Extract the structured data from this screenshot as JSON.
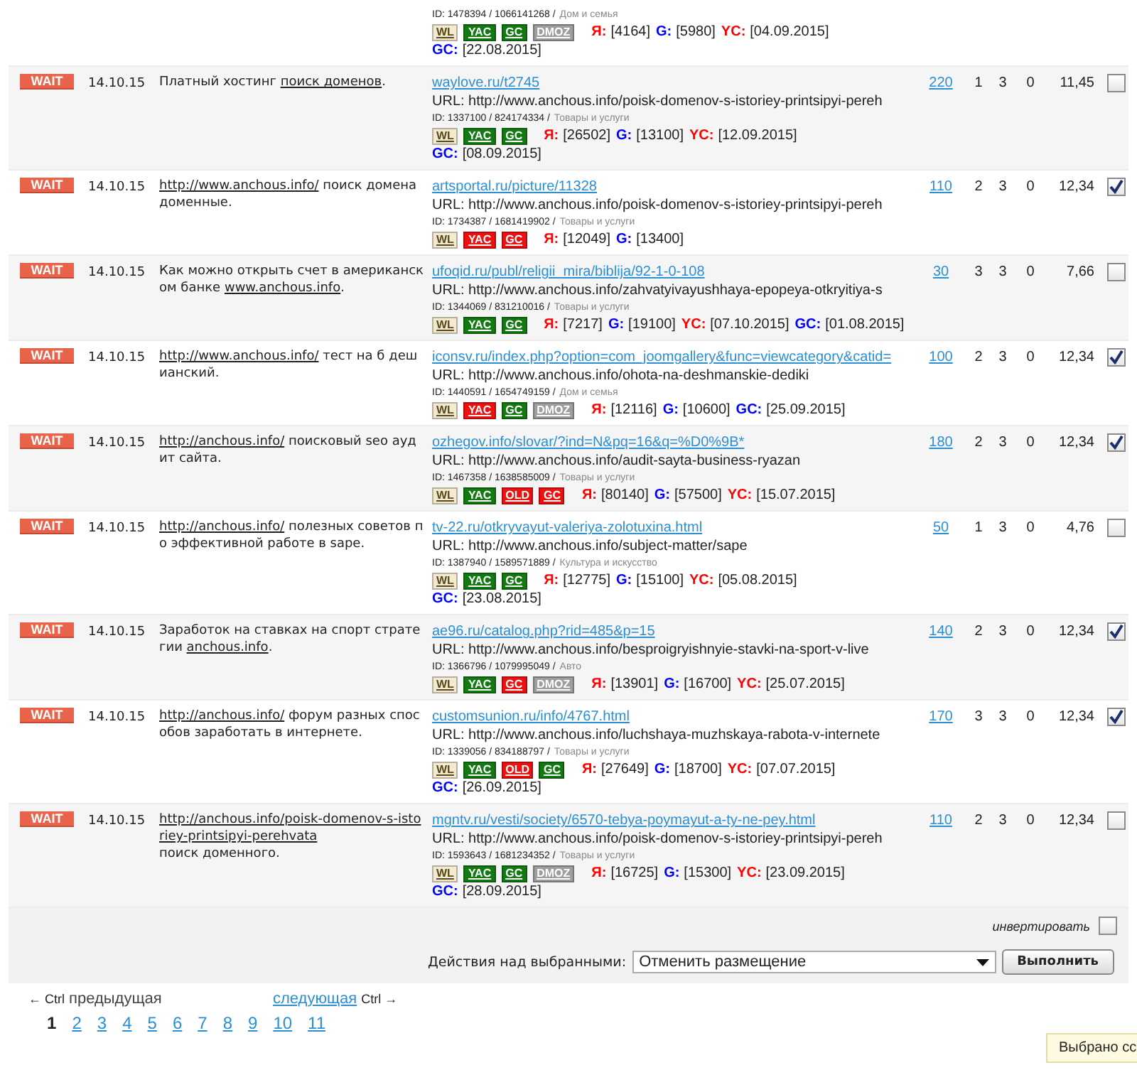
{
  "rows": [
    {
      "id": "ID: 1478394 / 1066141268 /",
      "category": "Дом и семья",
      "badges": [
        {
          "label": "WL",
          "color": "#f3ead2"
        },
        {
          "label": "YAC",
          "color": "#137a13"
        },
        {
          "label": "GC",
          "color": "#137a13"
        },
        {
          "label": "DMOZ",
          "color": "#9e9e9e"
        }
      ],
      "metrics": [
        {
          "label": "Я:",
          "value": "[4164]",
          "color": "#ff0000"
        },
        {
          "label": "G:",
          "value": "[5980]",
          "color": "#0000ff"
        },
        {
          "label": "YC:",
          "value": "[04.09.2015]",
          "color": "#ff0000"
        }
      ],
      "metrics_line2": [
        {
          "label": "GC:",
          "value": "[22.08.2015]",
          "color": "#0000ff"
        }
      ]
    },
    {
      "status": "WAIT",
      "date": "14.10.15",
      "description": [
        {
          "kind": "text",
          "text": "Платный хостинг "
        },
        {
          "kind": "link",
          "text": "поиск доменов"
        },
        {
          "kind": "text",
          "text": "."
        }
      ],
      "site": "waylove.ru/t2745",
      "url": "URL: http://www.anchous.info/poisk-domenov-s-istoriey-printsipyi-pereh",
      "id": "ID: 1337100 / 824174334 /",
      "category": "Товары и услуги",
      "badges": [
        {
          "label": "WL",
          "color": "#f3ead2"
        },
        {
          "label": "YAC",
          "color": "#137a13"
        },
        {
          "label": "GC",
          "color": "#137a13"
        }
      ],
      "metrics": [
        {
          "label": "Я:",
          "value": "[26502]",
          "color": "#ff0000"
        },
        {
          "label": "G:",
          "value": "[13100]",
          "color": "#0000ff"
        },
        {
          "label": "YC:",
          "value": "[12.09.2015]",
          "color": "#ff0000"
        }
      ],
      "metrics_line2": [
        {
          "label": "GC:",
          "value": "[08.09.2015]",
          "color": "#0000ff"
        }
      ],
      "price": "220",
      "n1": "1",
      "n2": "3",
      "n3": "0",
      "amount": "11,45",
      "checked": false
    },
    {
      "status": "WAIT",
      "date": "14.10.15",
      "description": [
        {
          "kind": "link",
          "text": "http://www.anchous.info/"
        },
        {
          "kind": "text",
          "text": " поиск домена доменные."
        }
      ],
      "site": "artsportal.ru/picture/11328",
      "url": "URL: http://www.anchous.info/poisk-domenov-s-istoriey-printsipyi-pereh",
      "id": "ID: 1734387 / 1681419902 /",
      "category": "Товары и услуги",
      "badges": [
        {
          "label": "WL",
          "color": "#f3ead2"
        },
        {
          "label": "YAC",
          "color": "#ee1111"
        },
        {
          "label": "GC",
          "color": "#ee1111"
        }
      ],
      "metrics": [
        {
          "label": "Я:",
          "value": "[12049]",
          "color": "#ff0000"
        },
        {
          "label": "G:",
          "value": "[13400]",
          "color": "#0000ff"
        }
      ],
      "price": "110",
      "n1": "2",
      "n2": "3",
      "n3": "0",
      "amount": "12,34",
      "checked": true
    },
    {
      "status": "WAIT",
      "date": "14.10.15",
      "description": [
        {
          "kind": "text",
          "text": "Как можно открыть счет в американском банке "
        },
        {
          "kind": "link",
          "text": "www.anchous.info"
        },
        {
          "kind": "text",
          "text": "."
        }
      ],
      "site": "ufoqid.ru/publ/religii_mira/biblija/92-1-0-108",
      "url": "URL: http://www.anchous.info/zahvatyivayushhaya-epopeya-otkryitiya-s",
      "id": "ID: 1344069 / 831210016 /",
      "category": "Товары и услуги",
      "badges": [
        {
          "label": "WL",
          "color": "#f3ead2"
        },
        {
          "label": "YAC",
          "color": "#137a13"
        },
        {
          "label": "GC",
          "color": "#137a13"
        }
      ],
      "metrics": [
        {
          "label": "Я:",
          "value": "[7217]",
          "color": "#ff0000"
        },
        {
          "label": "G:",
          "value": "[19100]",
          "color": "#0000ff"
        },
        {
          "label": "YC:",
          "value": "[07.10.2015]",
          "color": "#ff0000"
        },
        {
          "label": "GC:",
          "value": "[01.08.2015]",
          "color": "#0000ff"
        }
      ],
      "price": "30",
      "n1": "3",
      "n2": "3",
      "n3": "0",
      "amount": "7,66",
      "checked": false
    },
    {
      "status": "WAIT",
      "date": "14.10.15",
      "description": [
        {
          "kind": "link",
          "text": "http://www.anchous.info/"
        },
        {
          "kind": "text",
          "text": " тест на б дешианский."
        }
      ],
      "site": "iconsv.ru/index.php?option=com_joomgallery&func=viewcategory&catid=",
      "url": "URL: http://www.anchous.info/ohota-na-deshmanskie-dediki",
      "id": "ID: 1440591 / 1654749159 /",
      "category": "Дом и семья",
      "badges": [
        {
          "label": "WL",
          "color": "#f3ead2"
        },
        {
          "label": "YAC",
          "color": "#ee1111"
        },
        {
          "label": "GC",
          "color": "#137a13"
        },
        {
          "label": "DMOZ",
          "color": "#9e9e9e"
        }
      ],
      "metrics": [
        {
          "label": "Я:",
          "value": "[12116]",
          "color": "#ff0000"
        },
        {
          "label": "G:",
          "value": "[10600]",
          "color": "#0000ff"
        },
        {
          "label": "GC:",
          "value": "[25.09.2015]",
          "color": "#0000ff"
        }
      ],
      "price": "100",
      "n1": "2",
      "n2": "3",
      "n3": "0",
      "amount": "12,34",
      "checked": true
    },
    {
      "status": "WAIT",
      "date": "14.10.15",
      "description": [
        {
          "kind": "link",
          "text": "http://anchous.info/"
        },
        {
          "kind": "text",
          "text": " поисковый seo аудит сайта."
        }
      ],
      "site": "ozhegov.info/slovar/?ind=N&pq=16&q=%D0%9B*",
      "url": "URL: http://www.anchous.info/audit-sayta-business-ryazan",
      "id": "ID: 1467358 / 1638585009 /",
      "category": "Товары и услуги",
      "badges": [
        {
          "label": "WL",
          "color": "#f3ead2"
        },
        {
          "label": "YAC",
          "color": "#137a13"
        },
        {
          "label": "OLD",
          "color": "#ee1111"
        },
        {
          "label": "GC",
          "color": "#ee1111"
        }
      ],
      "metrics": [
        {
          "label": "Я:",
          "value": "[80140]",
          "color": "#ff0000"
        },
        {
          "label": "G:",
          "value": "[57500]",
          "color": "#0000ff"
        },
        {
          "label": "YC:",
          "value": "[15.07.2015]",
          "color": "#ff0000"
        }
      ],
      "price": "180",
      "n1": "2",
      "n2": "3",
      "n3": "0",
      "amount": "12,34",
      "checked": true
    },
    {
      "status": "WAIT",
      "date": "14.10.15",
      "description": [
        {
          "kind": "link",
          "text": "http://anchous.info/"
        },
        {
          "kind": "text",
          "text": " полезных советов по эффективной работе в sape."
        }
      ],
      "site": "tv-22.ru/otkryvayut-valeriya-zolotuxina.html",
      "url": "URL: http://www.anchous.info/subject-matter/sape",
      "id": "ID: 1387940 / 1589571889 /",
      "category": "Культура и искусство",
      "badges": [
        {
          "label": "WL",
          "color": "#f3ead2"
        },
        {
          "label": "YAC",
          "color": "#137a13"
        },
        {
          "label": "GC",
          "color": "#137a13"
        }
      ],
      "metrics": [
        {
          "label": "Я:",
          "value": "[12775]",
          "color": "#ff0000"
        },
        {
          "label": "G:",
          "value": "[15100]",
          "color": "#0000ff"
        },
        {
          "label": "YC:",
          "value": "[05.08.2015]",
          "color": "#ff0000"
        }
      ],
      "metrics_line2": [
        {
          "label": "GC:",
          "value": "[23.08.2015]",
          "color": "#0000ff"
        }
      ],
      "price": "50",
      "n1": "1",
      "n2": "3",
      "n3": "0",
      "amount": "4,76",
      "checked": false
    },
    {
      "status": "WAIT",
      "date": "14.10.15",
      "description": [
        {
          "kind": "text",
          "text": "Заработок на ставках на спорт стратегии "
        },
        {
          "kind": "link",
          "text": "anchous.info"
        },
        {
          "kind": "text",
          "text": "."
        }
      ],
      "site": "ae96.ru/catalog.php?rid=485&p=15",
      "url": "URL: http://www.anchous.info/besproigryishnyie-stavki-na-sport-v-live",
      "id": "ID: 1366796 / 1079995049 /",
      "category": "Авто",
      "badges": [
        {
          "label": "WL",
          "color": "#f3ead2"
        },
        {
          "label": "YAC",
          "color": "#137a13"
        },
        {
          "label": "GC",
          "color": "#ee1111"
        },
        {
          "label": "DMOZ",
          "color": "#9e9e9e"
        }
      ],
      "metrics": [
        {
          "label": "Я:",
          "value": "[13901]",
          "color": "#ff0000"
        },
        {
          "label": "G:",
          "value": "[16700]",
          "color": "#0000ff"
        },
        {
          "label": "YC:",
          "value": "[25.07.2015]",
          "color": "#ff0000"
        }
      ],
      "price": "140",
      "n1": "2",
      "n2": "3",
      "n3": "0",
      "amount": "12,34",
      "checked": true
    },
    {
      "status": "WAIT",
      "date": "14.10.15",
      "description": [
        {
          "kind": "link",
          "text": "http://anchous.info/"
        },
        {
          "kind": "text",
          "text": " форум разных способов заработать в интернете."
        }
      ],
      "site": "customsunion.ru/info/4767.html",
      "url": "URL: http://www.anchous.info/luchshaya-muzhskaya-rabota-v-internete",
      "id": "ID: 1339056 / 834188797 /",
      "category": "Товары и услуги",
      "badges": [
        {
          "label": "WL",
          "color": "#f3ead2"
        },
        {
          "label": "YAC",
          "color": "#137a13"
        },
        {
          "label": "OLD",
          "color": "#ee1111"
        },
        {
          "label": "GC",
          "color": "#137a13"
        }
      ],
      "metrics": [
        {
          "label": "Я:",
          "value": "[27649]",
          "color": "#ff0000"
        },
        {
          "label": "G:",
          "value": "[18700]",
          "color": "#0000ff"
        },
        {
          "label": "YC:",
          "value": "[07.07.2015]",
          "color": "#ff0000"
        }
      ],
      "metrics_line2": [
        {
          "label": "GC:",
          "value": "[26.09.2015]",
          "color": "#0000ff"
        }
      ],
      "price": "170",
      "n1": "3",
      "n2": "3",
      "n3": "0",
      "amount": "12,34",
      "checked": true
    },
    {
      "status": "WAIT",
      "date": "14.10.15",
      "description": [
        {
          "kind": "link",
          "text": "http://anchous.info/poisk-domenov-s-istoriey-printsipyi-perehvata"
        },
        {
          "kind": "text",
          "text": " поиск доменного."
        }
      ],
      "site": "mgntv.ru/vesti/society/6570-tebya-poymayut-a-ty-ne-pey.html",
      "url": "URL: http://www.anchous.info/poisk-domenov-s-istoriey-printsipyi-pereh",
      "id": "ID: 1593643 / 1681234352 /",
      "category": "Товары и услуги",
      "badges": [
        {
          "label": "WL",
          "color": "#f3ead2"
        },
        {
          "label": "YAC",
          "color": "#137a13"
        },
        {
          "label": "GC",
          "color": "#137a13"
        },
        {
          "label": "DMOZ",
          "color": "#9e9e9e"
        }
      ],
      "metrics": [
        {
          "label": "Я:",
          "value": "[16725]",
          "color": "#ff0000"
        },
        {
          "label": "G:",
          "value": "[15300]",
          "color": "#0000ff"
        },
        {
          "label": "YC:",
          "value": "[23.09.2015]",
          "color": "#ff0000"
        }
      ],
      "metrics_line2": [
        {
          "label": "GC:",
          "value": "[28.09.2015]",
          "color": "#0000ff"
        }
      ],
      "price": "110",
      "n1": "2",
      "n2": "3",
      "n3": "0",
      "amount": "12,34",
      "checked": false
    }
  ],
  "invert": {
    "label": "инвертировать",
    "checked": false
  },
  "actions": {
    "label": "Действия над выбранными:",
    "value": "Отменить размещение",
    "button": "Выполнить"
  },
  "pagination": {
    "prev_hint": "← Ctrl",
    "prev": {
      "label": "предыдущая",
      "disabled": true
    },
    "next": {
      "label": "следующая",
      "disabled": false
    },
    "next_hint": "Ctrl →",
    "pages": [
      {
        "label": "1",
        "selected": true
      },
      {
        "label": "2",
        "selected": false
      },
      {
        "label": "3",
        "selected": false
      },
      {
        "label": "4",
        "selected": false
      },
      {
        "label": "5",
        "selected": false
      },
      {
        "label": "6",
        "selected": false
      },
      {
        "label": "7",
        "selected": false
      },
      {
        "label": "8",
        "selected": false
      },
      {
        "label": "9",
        "selected": false
      },
      {
        "label": "10",
        "selected": false
      },
      {
        "label": "11",
        "selected": false
      }
    ]
  },
  "tooltip": "Выбрано сс"
}
